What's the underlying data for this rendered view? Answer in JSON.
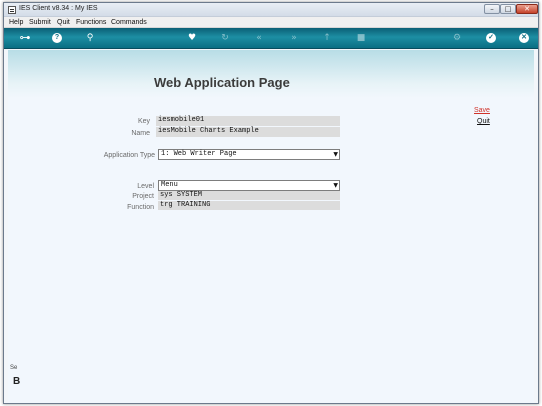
{
  "window": {
    "title": "IES Client v8.34 : My IES",
    "controls": {
      "minimize": "–",
      "maximize": "□",
      "close": "✕"
    }
  },
  "menu": {
    "items": [
      "Help",
      "Submit",
      "Quit",
      "Functions",
      "Commands"
    ]
  },
  "toolbar": {
    "icons": [
      "key-icon",
      "help-icon",
      "search-icon",
      "heart-icon",
      "refresh-icon",
      "rewind-icon",
      "fast-forward-icon",
      "upload-icon",
      "stop-icon",
      "settings-icon",
      "ok-icon",
      "close-icon"
    ],
    "glyphs": {
      "key": "⊶",
      "help": "?",
      "search": "⚲",
      "heart": "♥",
      "refresh": "↻",
      "rewind": "«",
      "fast_forward": "»",
      "upload": "↑",
      "stop": "■",
      "settings": "⚙",
      "ok": "✓",
      "close": "✕"
    }
  },
  "page": {
    "title": "Web Application Page",
    "save_label": "Save",
    "quit_label": "Quit"
  },
  "form": {
    "key_label": "Key",
    "key_value": "iesmobile01",
    "name_label": "Name",
    "name_value": "iesMobile Charts Example",
    "application_type_label": "Application Type",
    "application_type_value": "1: Web Writer Page",
    "level_label": "Level",
    "level_value": "Menu",
    "project_label": "Project",
    "project_value": "sys SYSTEM",
    "function_label": "Function",
    "function_value": "trg TRAINING"
  },
  "sidebar": {
    "fragment_text": "Se",
    "fragment_glyph": "B"
  },
  "colors": {
    "toolbar": "#1a879c",
    "banner": "#b8dde6",
    "save_link": "#d0322a",
    "field_background": "#dcdcdc"
  }
}
